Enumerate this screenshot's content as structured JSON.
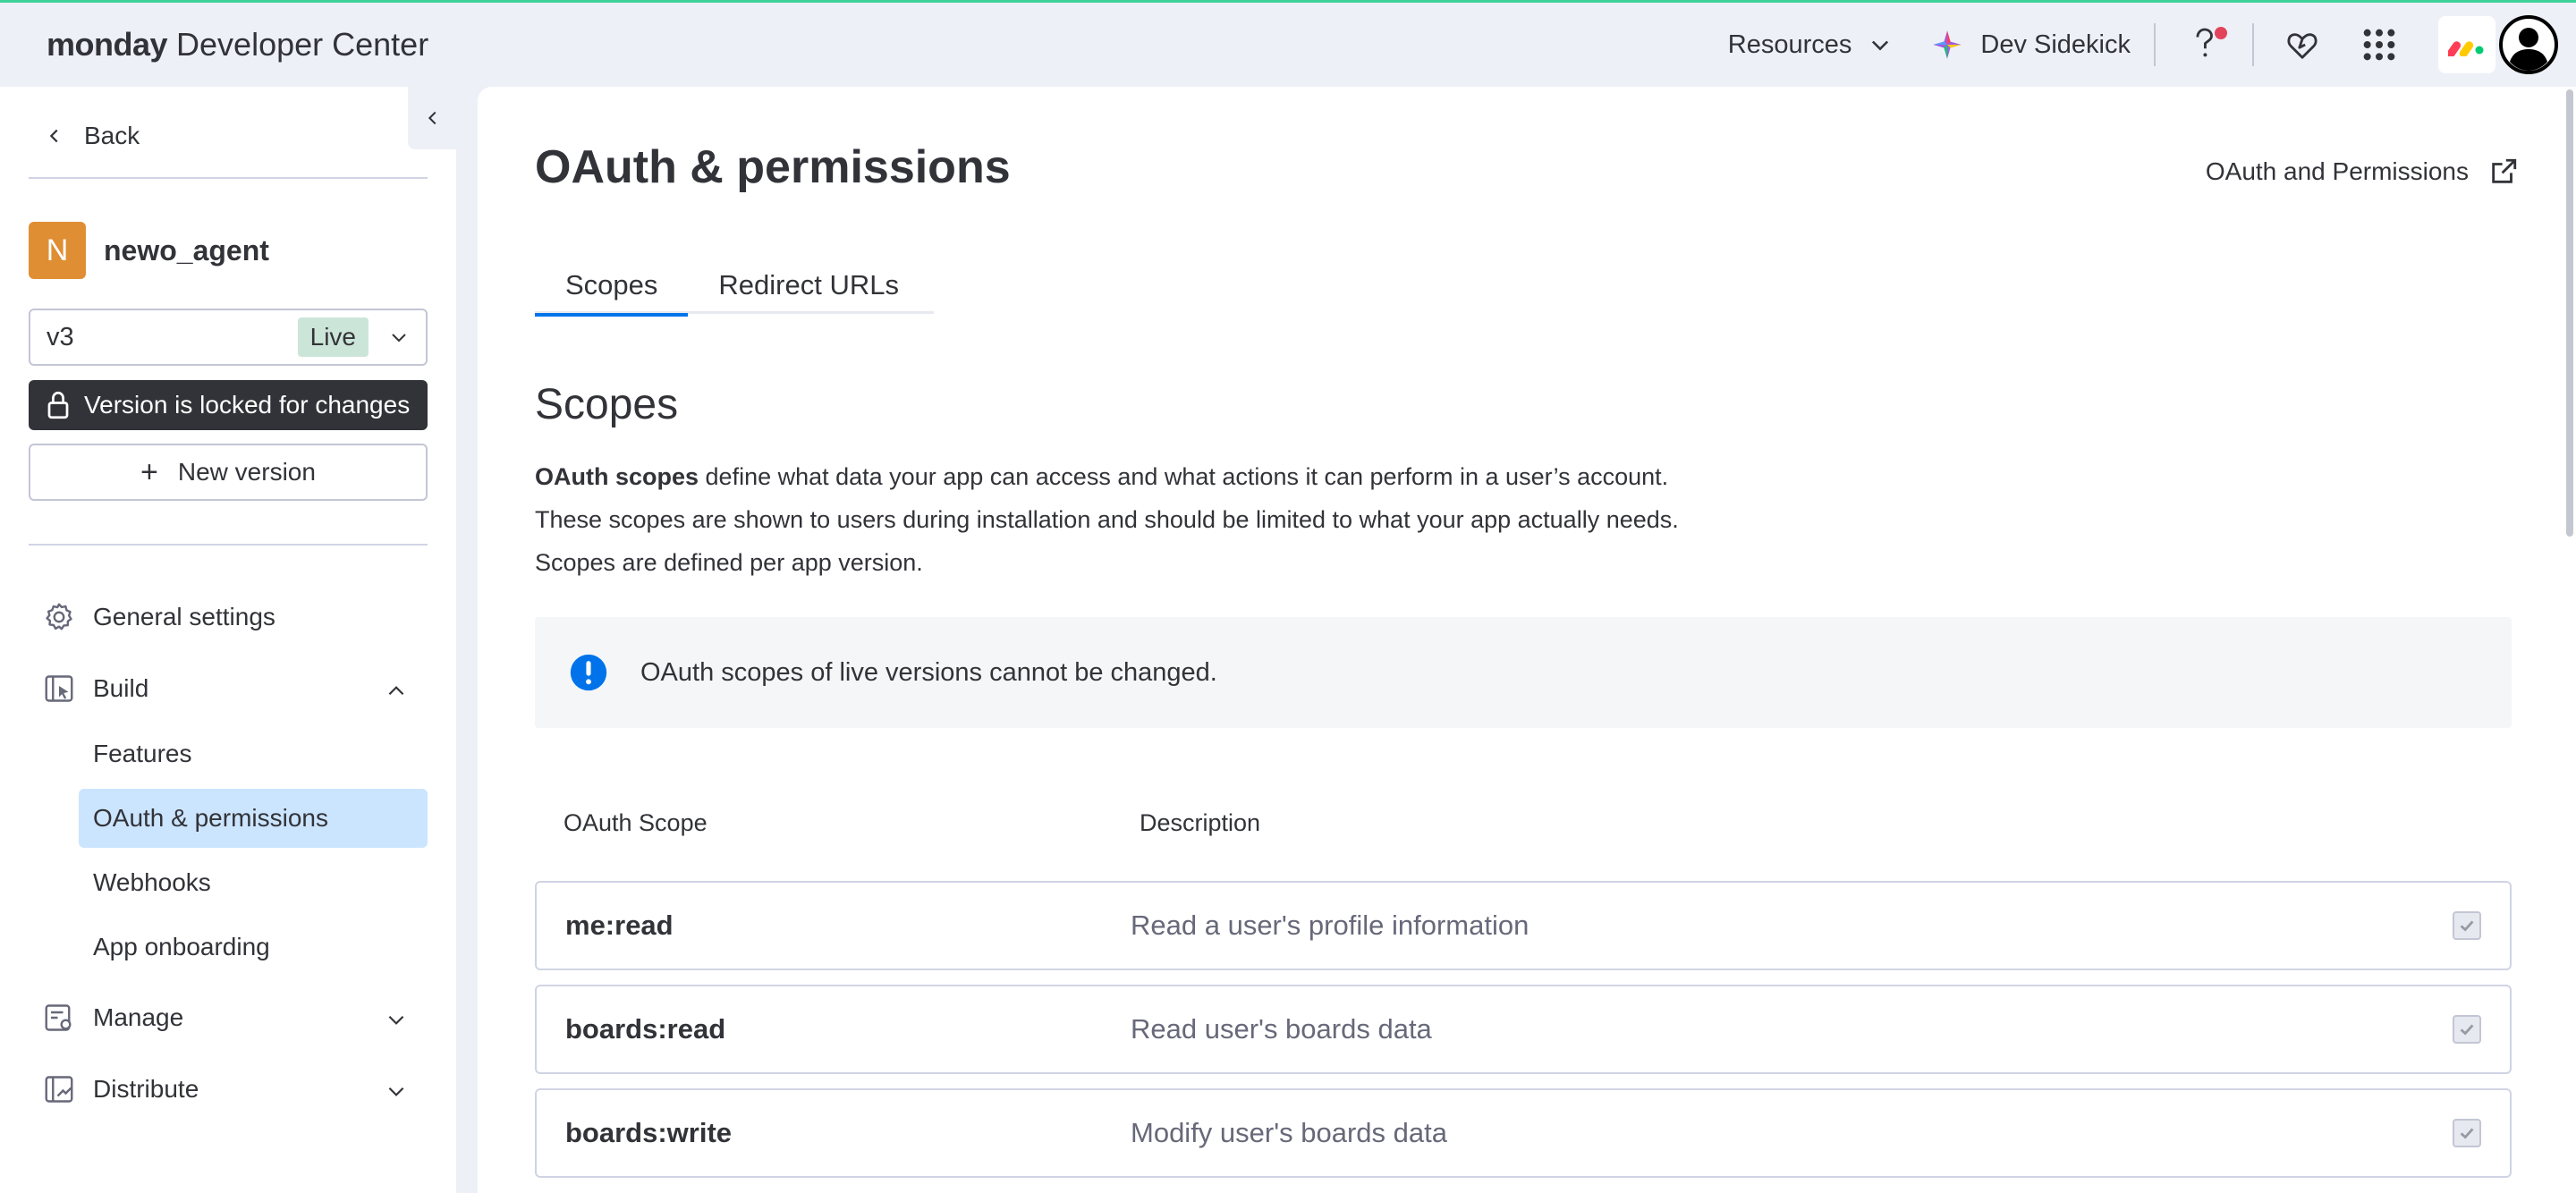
{
  "header": {
    "brand_bold": "monday",
    "brand_rest": " Developer Center",
    "resources_label": "Resources",
    "sidekick_label": "Dev Sidekick"
  },
  "sidebar": {
    "back_label": "Back",
    "app_initial": "N",
    "app_name": "newo_agent",
    "version_value": "v3",
    "version_status": "Live",
    "locked_label": "Version is locked for changes",
    "new_version_label": "New version",
    "nav": {
      "general_settings": "General settings",
      "build": "Build",
      "build_items": [
        "Features",
        "OAuth & permissions",
        "Webhooks",
        "App onboarding"
      ],
      "manage": "Manage",
      "distribute": "Distribute"
    }
  },
  "main": {
    "title": "OAuth & permissions",
    "doc_link": "OAuth and Permissions",
    "tabs": [
      "Scopes",
      "Redirect URLs"
    ],
    "section_title": "Scopes",
    "desc_bold": "OAuth scopes",
    "desc_line1_rest": " define what data your app can access and what actions it can perform in a user’s account.",
    "desc_line2": "These scopes are shown to users during installation and should be limited to what your app actually needs.",
    "desc_line3": "Scopes are defined per app version.",
    "alert_text": "OAuth scopes of live versions cannot be changed.",
    "table": {
      "headers": [
        "OAuth Scope",
        "Description"
      ],
      "rows": [
        {
          "scope": "me:read",
          "description": "Read a user's profile information",
          "checked": true
        },
        {
          "scope": "boards:read",
          "description": "Read user's boards data",
          "checked": true
        },
        {
          "scope": "boards:write",
          "description": "Modify user's boards data",
          "checked": true
        }
      ]
    }
  },
  "colors": {
    "accent": "#0073ea",
    "active_nav_bg": "#cce5ff",
    "live_badge_bg": "#cce5d9",
    "app_avatar": "#e08e33",
    "alert_icon": "#0073ea"
  }
}
